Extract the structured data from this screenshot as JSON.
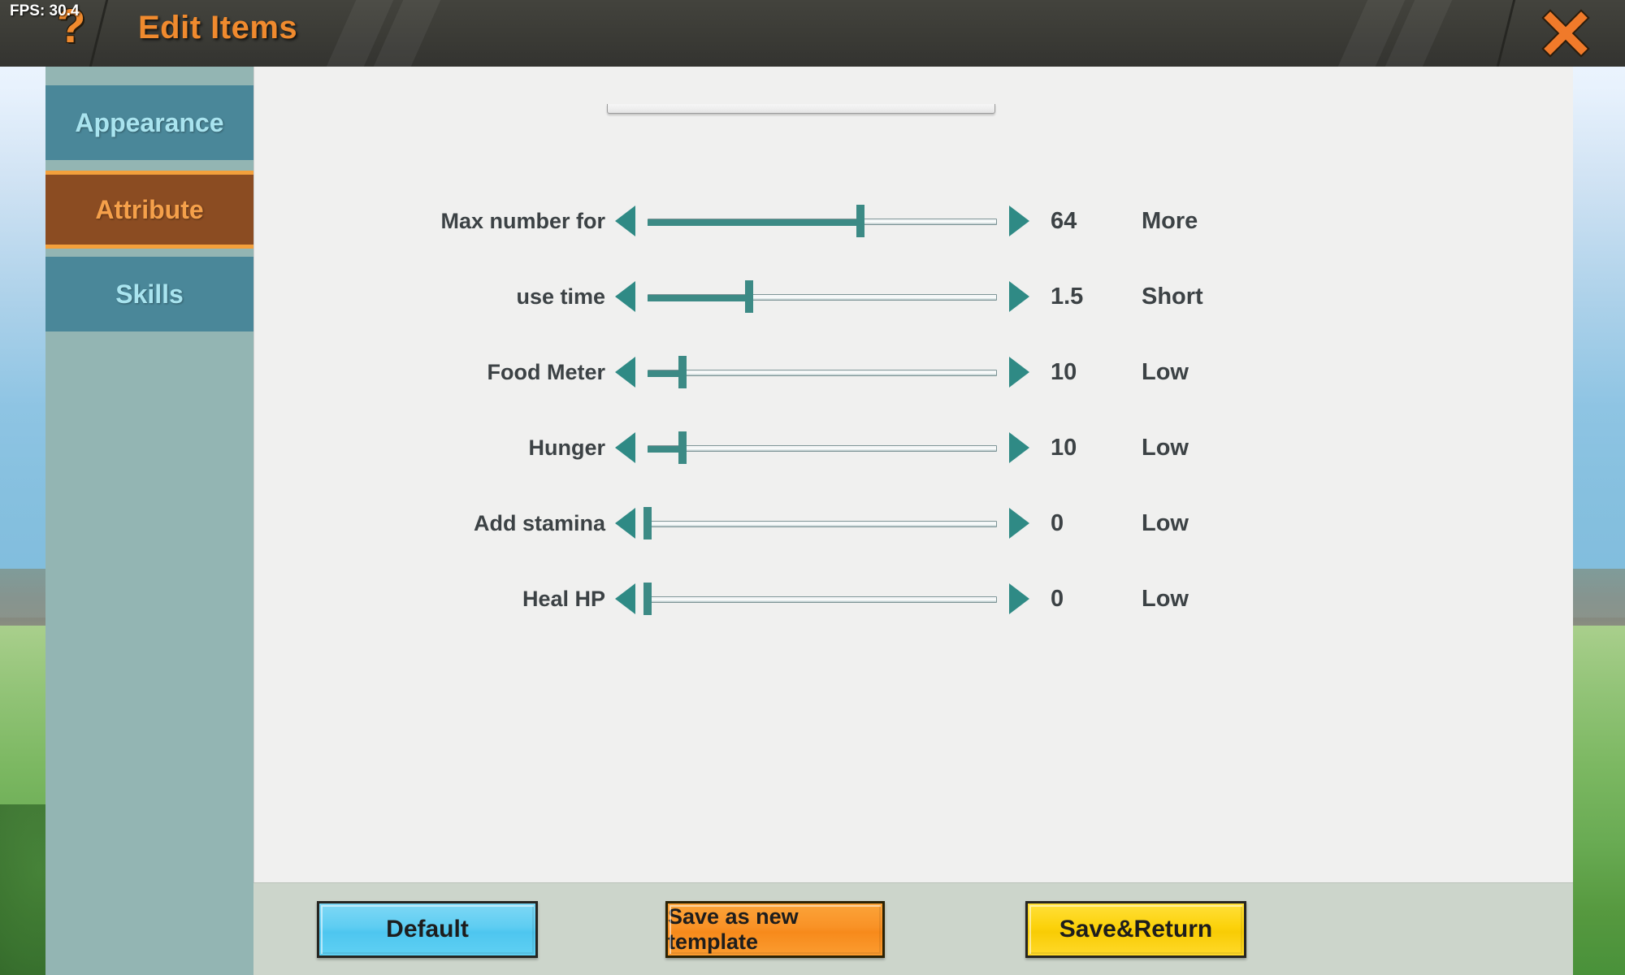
{
  "header": {
    "fps": "FPS: 30.4",
    "help_icon": "?",
    "title": "Edit Items",
    "close_icon": "close-x-icon"
  },
  "sidebar": {
    "tabs": [
      {
        "label": "Appearance",
        "active": false
      },
      {
        "label": "Attribute",
        "active": true
      },
      {
        "label": "Skills",
        "active": false
      }
    ]
  },
  "main": {
    "rows": [
      {
        "label": "Max number for",
        "value": "64",
        "desc": "More",
        "percent": 61
      },
      {
        "label": "use time",
        "value": "1.5",
        "desc": "Short",
        "percent": 29
      },
      {
        "label": "Food Meter",
        "value": "10",
        "desc": "Low",
        "percent": 10
      },
      {
        "label": "Hunger",
        "value": "10",
        "desc": "Low",
        "percent": 10
      },
      {
        "label": "Add stamina",
        "value": "0",
        "desc": "Low",
        "percent": 0
      },
      {
        "label": "Heal HP",
        "value": "0",
        "desc": "Low",
        "percent": 0
      }
    ],
    "decrement_icon": "triangle-left-icon",
    "increment_icon": "triangle-right-icon"
  },
  "footer": {
    "default_label": "Default",
    "template_label": "Save as new template",
    "save_label": "Save&Return"
  },
  "colors": {
    "accent_orange": "#f08a2e",
    "slider_teal": "#3c8a85",
    "tab_active_bg": "#8b4c22",
    "tab_inactive_bg": "#4a8799",
    "panel_bg": "#f0f0ef",
    "footer_bg": "#ccd5cb",
    "btn_default": "#5ecdf2",
    "btn_template": "#f99226",
    "btn_save": "#fcd20b"
  }
}
